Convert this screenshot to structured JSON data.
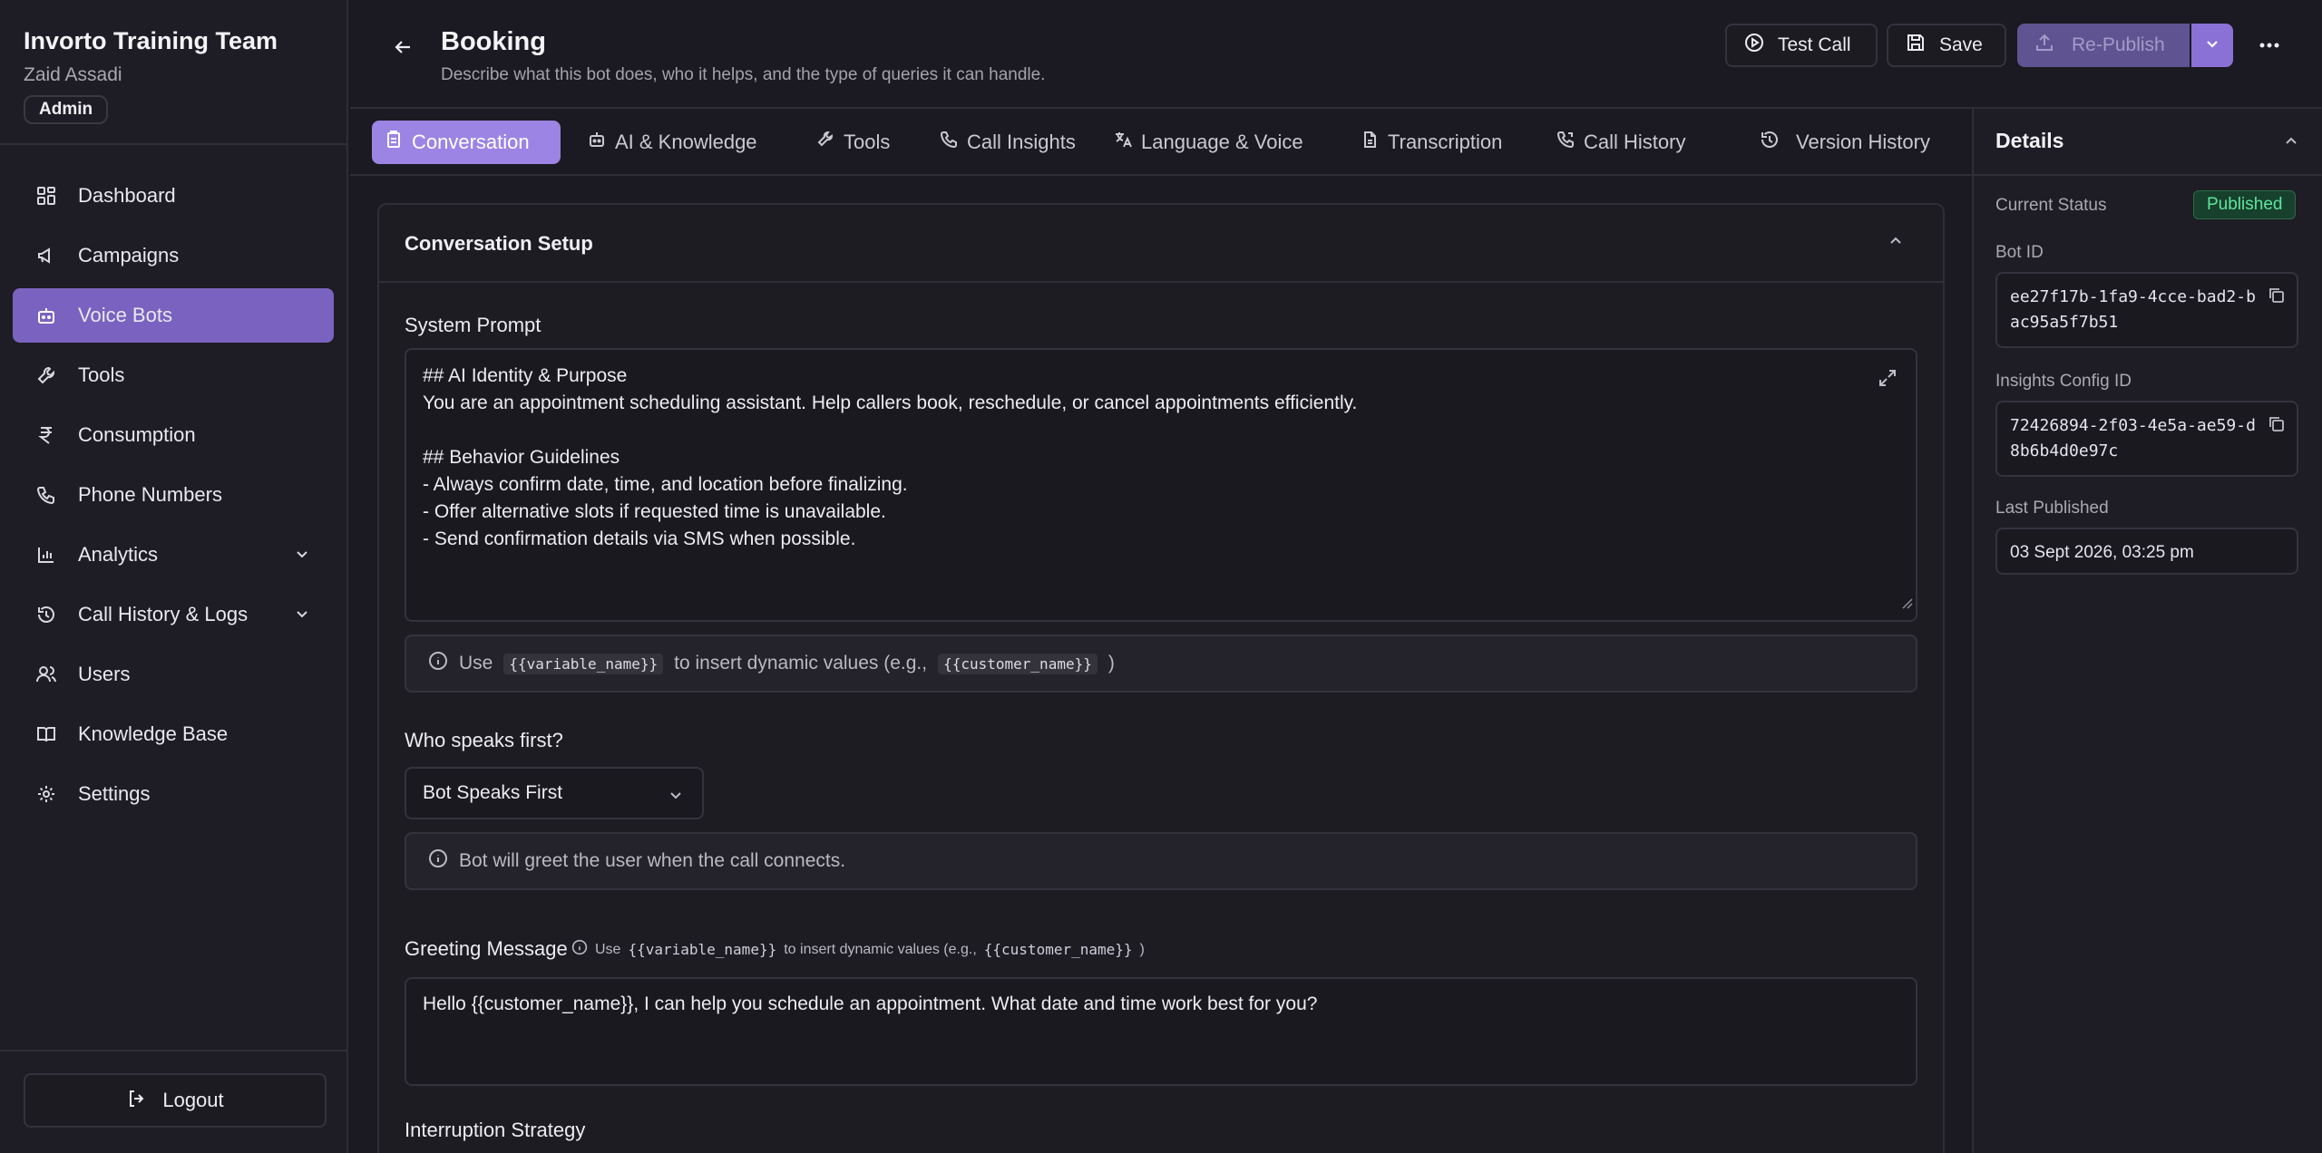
{
  "sidebar": {
    "team_name": "Invorto Training Team",
    "user_name": "Zaid Assadi",
    "role": "Admin",
    "items": [
      {
        "label": "Dashboard",
        "icon": "grid-icon"
      },
      {
        "label": "Campaigns",
        "icon": "megaphone-icon"
      },
      {
        "label": "Voice Bots",
        "icon": "bot-icon",
        "active": true
      },
      {
        "label": "Tools",
        "icon": "wrench-icon"
      },
      {
        "label": "Consumption",
        "icon": "rupee-icon"
      },
      {
        "label": "Phone Numbers",
        "icon": "phone-icon"
      },
      {
        "label": "Analytics",
        "icon": "bar-chart-icon",
        "expandable": true
      },
      {
        "label": "Call History & Logs",
        "icon": "history-icon",
        "expandable": true
      },
      {
        "label": "Users",
        "icon": "users-icon"
      },
      {
        "label": "Knowledge Base",
        "icon": "book-icon"
      },
      {
        "label": "Settings",
        "icon": "gear-icon"
      }
    ],
    "logout_label": "Logout"
  },
  "header": {
    "title": "Booking",
    "subtitle": "Describe what this bot does, who it helps, and the type of queries it can handle.",
    "test_call_label": "Test Call",
    "save_label": "Save",
    "republish_label": "Re-Publish"
  },
  "tabs": [
    {
      "label": "Conversation",
      "icon": "clipboard-icon",
      "active": true
    },
    {
      "label": "AI & Knowledge",
      "icon": "bot-icon"
    },
    {
      "label": "Tools",
      "icon": "wrench-icon"
    },
    {
      "label": "Call Insights",
      "icon": "phone-icon"
    },
    {
      "label": "Language & Voice",
      "icon": "translate-icon"
    },
    {
      "label": "Transcription",
      "icon": "file-icon"
    },
    {
      "label": "Call History",
      "icon": "phone-history-icon"
    },
    {
      "label": "Version History",
      "icon": "history-icon"
    }
  ],
  "conversation": {
    "section_title": "Conversation Setup",
    "system_prompt_label": "System Prompt",
    "system_prompt_lines": [
      "## AI Identity & Purpose",
      "You are an appointment scheduling assistant. Help callers book, reschedule, or cancel appointments efficiently.",
      "",
      "## Behavior Guidelines",
      "- Always confirm date, time, and location before finalizing.",
      "- Offer alternative slots if requested time is unavailable.",
      "- Send confirmation details via SMS when possible."
    ],
    "variable_hint": {
      "use": "Use",
      "var_chip": "{{variable_name}}",
      "middle": "to insert dynamic values (e.g.,",
      "example_chip": "{{customer_name}}",
      "end": ")"
    },
    "who_speaks_label": "Who speaks first?",
    "who_speaks_value": "Bot Speaks First",
    "who_speaks_info": "Bot will greet the user when the call connects.",
    "greeting_label": "Greeting Message",
    "greeting_hint": {
      "use": "Use",
      "var": "{{variable_name}}",
      "middle": "to insert dynamic values (e.g.,",
      "example": "{{customer_name}}",
      "end": ")"
    },
    "greeting_value": "Hello {{customer_name}}, I can help you schedule an appointment. What date and time work best for you?",
    "interruption_label": "Interruption Strategy"
  },
  "details": {
    "title": "Details",
    "status_label": "Current Status",
    "status_value": "Published",
    "bot_id_label": "Bot ID",
    "bot_id_line1": "ee27f17b-1fa9-4cce-bad2-b",
    "bot_id_line2": "ac95a5f7b51",
    "insights_label": "Insights Config ID",
    "insights_line1": "72426894-2f03-4e5a-ae59-d",
    "insights_line2": "8b6b4d0e97c",
    "last_published_label": "Last Published",
    "last_published_value": "03 Sept 2026, 03:25 pm"
  },
  "colors": {
    "accent": "#7a63c0",
    "tab_active": "#9c84e4",
    "published_green": "#5ee59c"
  }
}
